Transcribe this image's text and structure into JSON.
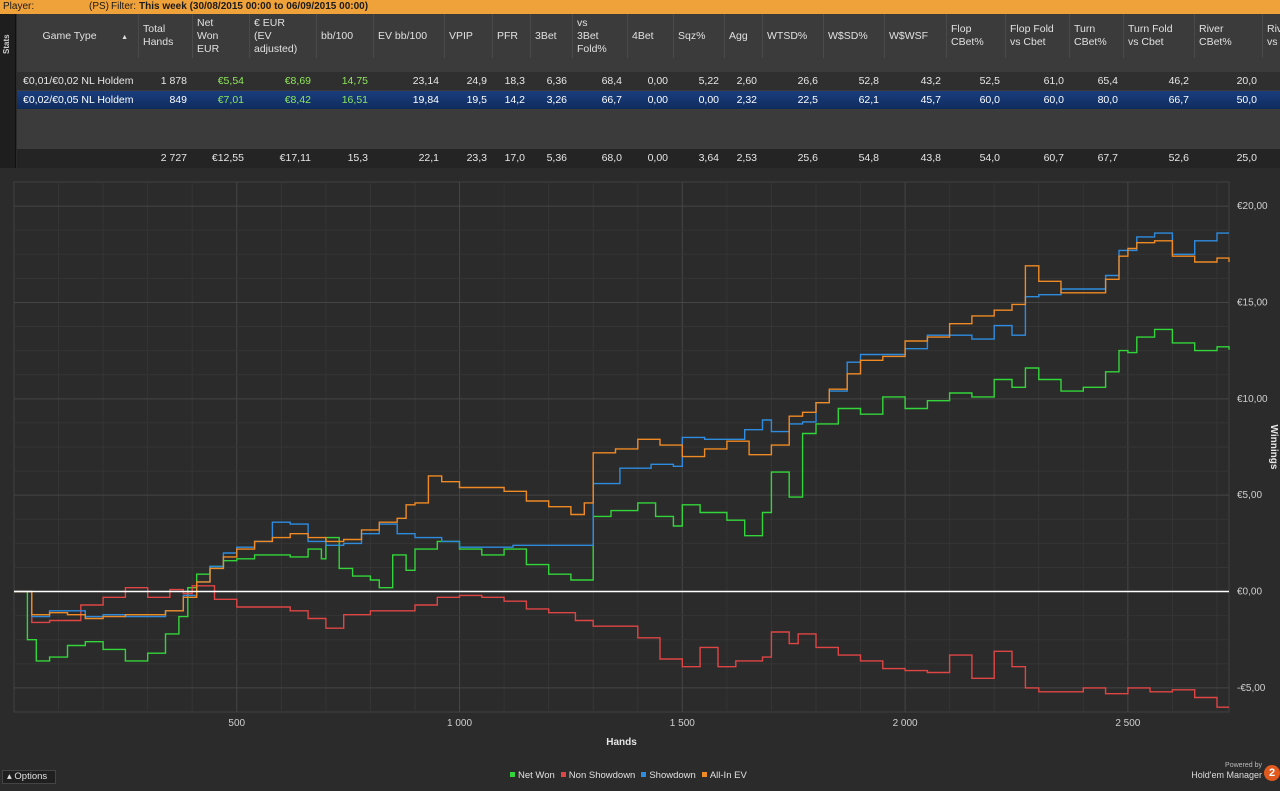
{
  "topbar": {
    "player_label": "Player:",
    "site_badge": "(PS)",
    "filter_label": "Filter:",
    "filter_value": "This week (30/08/2015 00:00 to 06/09/2015 00:00)"
  },
  "sidetab": {
    "label": "Stats"
  },
  "stats_table": {
    "columns": [
      "Game Type",
      "Total\nHands",
      "Net\nWon\nEUR",
      "€ EUR\n(EV\nadjusted)",
      "bb/100",
      "EV bb/100",
      "VPIP",
      "PFR",
      "3Bet",
      "vs\n3Bet\nFold%",
      "4Bet",
      "Sqz%",
      "Agg",
      "WTSD%",
      "W$SD%",
      "W$WSF",
      "Flop\nCBet%",
      "Flop Fold\nvs Cbet",
      "Turn\nCBet%",
      "Turn Fold\nvs Cbet",
      "River\nCBet%",
      "Rive\nvs C"
    ],
    "rows": [
      [
        "€0,01/€0,02 NL Holdem",
        "1 878",
        "€5,54",
        "€8,69",
        "14,75",
        "23,14",
        "24,9",
        "18,3",
        "6,36",
        "68,4",
        "0,00",
        "5,22",
        "2,60",
        "26,6",
        "52,8",
        "43,2",
        "52,5",
        "61,0",
        "65,4",
        "46,2",
        "20,0",
        ""
      ],
      [
        "€0,02/€0,05 NL Holdem",
        "849",
        "€7,01",
        "€8,42",
        "16,51",
        "19,84",
        "19,5",
        "14,2",
        "3,26",
        "66,7",
        "0,00",
        "0,00",
        "2,32",
        "22,5",
        "62,1",
        "45,7",
        "60,0",
        "60,0",
        "80,0",
        "66,7",
        "50,0",
        ""
      ]
    ],
    "totals": [
      "",
      "2 727",
      "€12,55",
      "€17,11",
      "15,3",
      "22,1",
      "23,3",
      "17,0",
      "5,36",
      "68,0",
      "0,00",
      "3,64",
      "2,53",
      "25,6",
      "54,8",
      "43,8",
      "54,0",
      "60,7",
      "67,7",
      "52,6",
      "25,0",
      ""
    ]
  },
  "chart_data": {
    "type": "line",
    "xlabel": "Hands",
    "ylabel": "Winnings",
    "xlim": [
      0,
      2727
    ],
    "ylim": [
      -6.25,
      21.25
    ],
    "x_ticks": [
      500,
      1000,
      1500,
      2000,
      2500
    ],
    "x_tick_labels": [
      "500",
      "1 000",
      "1 500",
      "2 000",
      "2 500"
    ],
    "y_ticks": [
      -5,
      0,
      5,
      10,
      15,
      20
    ],
    "y_tick_labels": [
      "-€5,00",
      "€0,00",
      "€5,00",
      "€10,00",
      "€15,00",
      "€20,00"
    ],
    "grid": true,
    "legend_position": "bottom-center",
    "series": [
      {
        "name": "Net Won",
        "color": "#33d63a",
        "points": [
          [
            0,
            0
          ],
          [
            30,
            -2.5
          ],
          [
            50,
            -3.6
          ],
          [
            80,
            -3.4
          ],
          [
            120,
            -2.8
          ],
          [
            160,
            -2.6
          ],
          [
            200,
            -3.0
          ],
          [
            250,
            -3.6
          ],
          [
            300,
            -3.2
          ],
          [
            340,
            -2.2
          ],
          [
            370,
            -1.3
          ],
          [
            390,
            0.2
          ],
          [
            410,
            0.9
          ],
          [
            440,
            1.3
          ],
          [
            470,
            1.6
          ],
          [
            500,
            1.7
          ],
          [
            540,
            1.9
          ],
          [
            580,
            1.9
          ],
          [
            620,
            1.8
          ],
          [
            660,
            2.2
          ],
          [
            690,
            1.7
          ],
          [
            700,
            2.8
          ],
          [
            730,
            1.2
          ],
          [
            760,
            0.8
          ],
          [
            800,
            0.6
          ],
          [
            820,
            0.2
          ],
          [
            850,
            1.9
          ],
          [
            880,
            1.1
          ],
          [
            900,
            2.2
          ],
          [
            950,
            2.6
          ],
          [
            1000,
            2.2
          ],
          [
            1050,
            1.9
          ],
          [
            1100,
            2.2
          ],
          [
            1150,
            1.4
          ],
          [
            1200,
            0.9
          ],
          [
            1250,
            0.6
          ],
          [
            1280,
            0.6
          ],
          [
            1300,
            3.9
          ],
          [
            1340,
            4.2
          ],
          [
            1400,
            4.6
          ],
          [
            1440,
            3.9
          ],
          [
            1480,
            3.4
          ],
          [
            1500,
            4.5
          ],
          [
            1540,
            4.1
          ],
          [
            1600,
            3.7
          ],
          [
            1640,
            2.9
          ],
          [
            1680,
            4.1
          ],
          [
            1700,
            6.2
          ],
          [
            1740,
            4.9
          ],
          [
            1770,
            8.2
          ],
          [
            1800,
            8.7
          ],
          [
            1850,
            9.5
          ],
          [
            1900,
            9.2
          ],
          [
            1950,
            10.1
          ],
          [
            2000,
            9.5
          ],
          [
            2050,
            9.9
          ],
          [
            2100,
            10.3
          ],
          [
            2150,
            10.1
          ],
          [
            2200,
            11.0
          ],
          [
            2240,
            10.6
          ],
          [
            2270,
            11.6
          ],
          [
            2300,
            11.0
          ],
          [
            2350,
            10.4
          ],
          [
            2400,
            10.6
          ],
          [
            2450,
            11.4
          ],
          [
            2480,
            12.5
          ],
          [
            2500,
            12.4
          ],
          [
            2520,
            13.2
          ],
          [
            2560,
            13.6
          ],
          [
            2600,
            12.9
          ],
          [
            2650,
            12.5
          ],
          [
            2700,
            12.7
          ],
          [
            2727,
            12.55
          ]
        ]
      },
      {
        "name": "Non Showdown",
        "color": "#e04545",
        "points": [
          [
            0,
            0
          ],
          [
            40,
            -1.6
          ],
          [
            80,
            -1.5
          ],
          [
            150,
            -0.7
          ],
          [
            200,
            -0.3
          ],
          [
            250,
            0.2
          ],
          [
            300,
            -0.3
          ],
          [
            350,
            0.1
          ],
          [
            380,
            -0.1
          ],
          [
            400,
            0.3
          ],
          [
            450,
            -0.4
          ],
          [
            500,
            -0.8
          ],
          [
            560,
            -0.8
          ],
          [
            620,
            -1.0
          ],
          [
            660,
            -1.4
          ],
          [
            700,
            -1.9
          ],
          [
            740,
            -1.2
          ],
          [
            800,
            -1.0
          ],
          [
            860,
            -1.0
          ],
          [
            900,
            -0.7
          ],
          [
            950,
            -0.3
          ],
          [
            1000,
            -0.2
          ],
          [
            1050,
            -0.3
          ],
          [
            1100,
            -0.5
          ],
          [
            1150,
            -0.9
          ],
          [
            1200,
            -1.1
          ],
          [
            1260,
            -1.5
          ],
          [
            1300,
            -1.8
          ],
          [
            1350,
            -1.8
          ],
          [
            1400,
            -2.4
          ],
          [
            1450,
            -3.5
          ],
          [
            1500,
            -3.9
          ],
          [
            1540,
            -2.9
          ],
          [
            1580,
            -3.9
          ],
          [
            1620,
            -3.6
          ],
          [
            1680,
            -3.4
          ],
          [
            1700,
            -2.1
          ],
          [
            1740,
            -2.7
          ],
          [
            1760,
            -2.2
          ],
          [
            1780,
            -2.2
          ],
          [
            1800,
            -2.9
          ],
          [
            1850,
            -3.3
          ],
          [
            1900,
            -3.6
          ],
          [
            1950,
            -4.0
          ],
          [
            2000,
            -4.1
          ],
          [
            2050,
            -4.2
          ],
          [
            2100,
            -3.3
          ],
          [
            2150,
            -4.5
          ],
          [
            2200,
            -3.1
          ],
          [
            2240,
            -3.9
          ],
          [
            2270,
            -5.0
          ],
          [
            2300,
            -5.2
          ],
          [
            2400,
            -5.0
          ],
          [
            2450,
            -5.3
          ],
          [
            2500,
            -5.0
          ],
          [
            2550,
            -5.2
          ],
          [
            2600,
            -5.1
          ],
          [
            2650,
            -5.5
          ],
          [
            2700,
            -6.0
          ],
          [
            2727,
            -6.0
          ]
        ]
      },
      {
        "name": "Showdown",
        "color": "#2e8ce0",
        "points": [
          [
            0,
            0
          ],
          [
            40,
            -1.3
          ],
          [
            80,
            -1.0
          ],
          [
            120,
            -1.0
          ],
          [
            160,
            -1.3
          ],
          [
            200,
            -1.2
          ],
          [
            250,
            -1.3
          ],
          [
            300,
            -1.3
          ],
          [
            340,
            -1.0
          ],
          [
            380,
            -0.2
          ],
          [
            410,
            0.5
          ],
          [
            440,
            1.3
          ],
          [
            470,
            2.0
          ],
          [
            500,
            2.3
          ],
          [
            540,
            2.6
          ],
          [
            580,
            3.6
          ],
          [
            620,
            3.5
          ],
          [
            660,
            2.6
          ],
          [
            700,
            2.4
          ],
          [
            740,
            2.5
          ],
          [
            780,
            3.0
          ],
          [
            820,
            3.5
          ],
          [
            860,
            3.0
          ],
          [
            900,
            2.8
          ],
          [
            960,
            2.6
          ],
          [
            1000,
            2.3
          ],
          [
            1060,
            2.3
          ],
          [
            1120,
            2.4
          ],
          [
            1180,
            2.4
          ],
          [
            1240,
            2.4
          ],
          [
            1290,
            2.4
          ],
          [
            1300,
            5.6
          ],
          [
            1360,
            6.4
          ],
          [
            1430,
            6.6
          ],
          [
            1480,
            6.5
          ],
          [
            1500,
            8.0
          ],
          [
            1550,
            7.9
          ],
          [
            1600,
            7.9
          ],
          [
            1640,
            8.4
          ],
          [
            1680,
            8.9
          ],
          [
            1700,
            8.3
          ],
          [
            1740,
            8.7
          ],
          [
            1770,
            8.8
          ],
          [
            1800,
            9.8
          ],
          [
            1830,
            10.4
          ],
          [
            1870,
            11.9
          ],
          [
            1900,
            12.3
          ],
          [
            1950,
            12.3
          ],
          [
            2000,
            12.6
          ],
          [
            2050,
            13.3
          ],
          [
            2100,
            13.3
          ],
          [
            2150,
            13.1
          ],
          [
            2200,
            13.8
          ],
          [
            2240,
            13.3
          ],
          [
            2270,
            15.3
          ],
          [
            2300,
            15.4
          ],
          [
            2350,
            15.7
          ],
          [
            2400,
            15.7
          ],
          [
            2450,
            16.4
          ],
          [
            2480,
            17.7
          ],
          [
            2500,
            17.7
          ],
          [
            2520,
            18.4
          ],
          [
            2560,
            18.6
          ],
          [
            2600,
            17.5
          ],
          [
            2650,
            18.2
          ],
          [
            2700,
            18.6
          ],
          [
            2727,
            18.6
          ]
        ]
      },
      {
        "name": "All-In EV",
        "color": "#f08a24",
        "points": [
          [
            0,
            0
          ],
          [
            40,
            -1.2
          ],
          [
            80,
            -1.1
          ],
          [
            120,
            -1.2
          ],
          [
            160,
            -1.4
          ],
          [
            200,
            -1.3
          ],
          [
            250,
            -1.2
          ],
          [
            300,
            -1.2
          ],
          [
            340,
            -1.0
          ],
          [
            380,
            -0.3
          ],
          [
            410,
            0.5
          ],
          [
            440,
            1.2
          ],
          [
            470,
            1.8
          ],
          [
            500,
            2.2
          ],
          [
            540,
            2.6
          ],
          [
            580,
            2.8
          ],
          [
            620,
            3.0
          ],
          [
            660,
            2.8
          ],
          [
            700,
            2.6
          ],
          [
            740,
            2.7
          ],
          [
            780,
            3.2
          ],
          [
            820,
            3.6
          ],
          [
            860,
            3.8
          ],
          [
            880,
            4.5
          ],
          [
            900,
            4.6
          ],
          [
            930,
            6.0
          ],
          [
            960,
            5.7
          ],
          [
            1000,
            5.4
          ],
          [
            1050,
            5.4
          ],
          [
            1100,
            5.2
          ],
          [
            1150,
            4.7
          ],
          [
            1200,
            4.4
          ],
          [
            1250,
            4.0
          ],
          [
            1280,
            4.6
          ],
          [
            1300,
            7.2
          ],
          [
            1350,
            7.4
          ],
          [
            1400,
            7.9
          ],
          [
            1450,
            7.6
          ],
          [
            1500,
            7.0
          ],
          [
            1550,
            7.4
          ],
          [
            1600,
            7.8
          ],
          [
            1650,
            7.1
          ],
          [
            1700,
            7.6
          ],
          [
            1740,
            9.1
          ],
          [
            1770,
            9.3
          ],
          [
            1800,
            9.8
          ],
          [
            1830,
            10.5
          ],
          [
            1870,
            11.3
          ],
          [
            1900,
            12.0
          ],
          [
            1950,
            12.2
          ],
          [
            2000,
            13.0
          ],
          [
            2050,
            13.2
          ],
          [
            2100,
            13.9
          ],
          [
            2150,
            14.3
          ],
          [
            2200,
            14.6
          ],
          [
            2240,
            14.9
          ],
          [
            2270,
            16.9
          ],
          [
            2300,
            16.1
          ],
          [
            2350,
            15.5
          ],
          [
            2400,
            15.5
          ],
          [
            2450,
            16.2
          ],
          [
            2480,
            17.4
          ],
          [
            2500,
            17.8
          ],
          [
            2520,
            18.1
          ],
          [
            2560,
            18.2
          ],
          [
            2600,
            17.4
          ],
          [
            2650,
            17.1
          ],
          [
            2700,
            17.3
          ],
          [
            2727,
            17.1
          ]
        ]
      }
    ]
  },
  "options_label": "Options",
  "branding": {
    "powered_by": "Powered by",
    "name": "Hold'em Manager",
    "logo": "2"
  }
}
